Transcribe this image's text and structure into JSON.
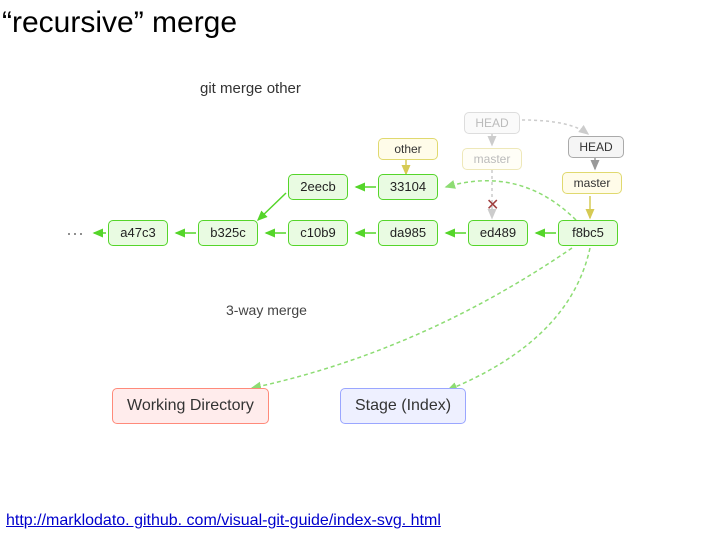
{
  "title": "“recursive” merge",
  "command": "git merge other",
  "labels": {
    "other": "other",
    "head": "HEAD",
    "master": "master"
  },
  "commits": {
    "a47c3": "a47c3",
    "b325c": "b325c",
    "c10b9": "c10b9",
    "da985": "da985",
    "ed489": "ed489",
    "f8bc5": "f8bc5",
    "n2eecb": "2eecb",
    "n33104": "33104"
  },
  "caption": "3-way merge",
  "working_dir": "Working Directory",
  "stage": "Stage (Index)",
  "url": "http://marklodato. github. com/visual-git-guide/index-svg. html",
  "chart_data": {
    "type": "diagram",
    "title": "\"recursive\" merge (git merge other)",
    "nodes": [
      {
        "id": "a47c3",
        "row": "main",
        "col": 0
      },
      {
        "id": "b325c",
        "row": "main",
        "col": 1
      },
      {
        "id": "c10b9",
        "row": "main",
        "col": 2
      },
      {
        "id": "da985",
        "row": "main",
        "col": 3
      },
      {
        "id": "ed489",
        "row": "main",
        "col": 4
      },
      {
        "id": "f8bc5",
        "row": "main",
        "col": 5,
        "new_merge_commit": true
      },
      {
        "id": "2eecb",
        "row": "topic",
        "col": 2
      },
      {
        "id": "33104",
        "row": "topic",
        "col": 3
      },
      {
        "id": "Working Directory",
        "row": "files"
      },
      {
        "id": "Stage (Index)",
        "row": "files"
      }
    ],
    "edges": [
      {
        "from": "b325c",
        "to": "a47c3",
        "kind": "parent"
      },
      {
        "from": "c10b9",
        "to": "b325c",
        "kind": "parent"
      },
      {
        "from": "da985",
        "to": "c10b9",
        "kind": "parent"
      },
      {
        "from": "ed489",
        "to": "da985",
        "kind": "parent"
      },
      {
        "from": "f8bc5",
        "to": "ed489",
        "kind": "parent"
      },
      {
        "from": "2eecb",
        "to": "b325c",
        "kind": "parent"
      },
      {
        "from": "33104",
        "to": "2eecb",
        "kind": "parent"
      },
      {
        "from": "f8bc5",
        "to": "33104",
        "kind": "parent"
      },
      {
        "from": "other",
        "to": "33104",
        "kind": "ref"
      },
      {
        "from": "HEAD(old)",
        "to": "master(old)",
        "kind": "ref-faded"
      },
      {
        "from": "master(old)",
        "to": "ed489",
        "kind": "ref-faded",
        "deleted": true
      },
      {
        "from": "HEAD(new)",
        "to": "master(new)",
        "kind": "ref"
      },
      {
        "from": "master(new)",
        "to": "f8bc5",
        "kind": "ref"
      },
      {
        "from": "f8bc5",
        "to": "Stage (Index)",
        "kind": "checkout"
      },
      {
        "from": "f8bc5",
        "to": "Working Directory",
        "kind": "checkout"
      }
    ],
    "annotations": [
      "3-way merge"
    ]
  }
}
